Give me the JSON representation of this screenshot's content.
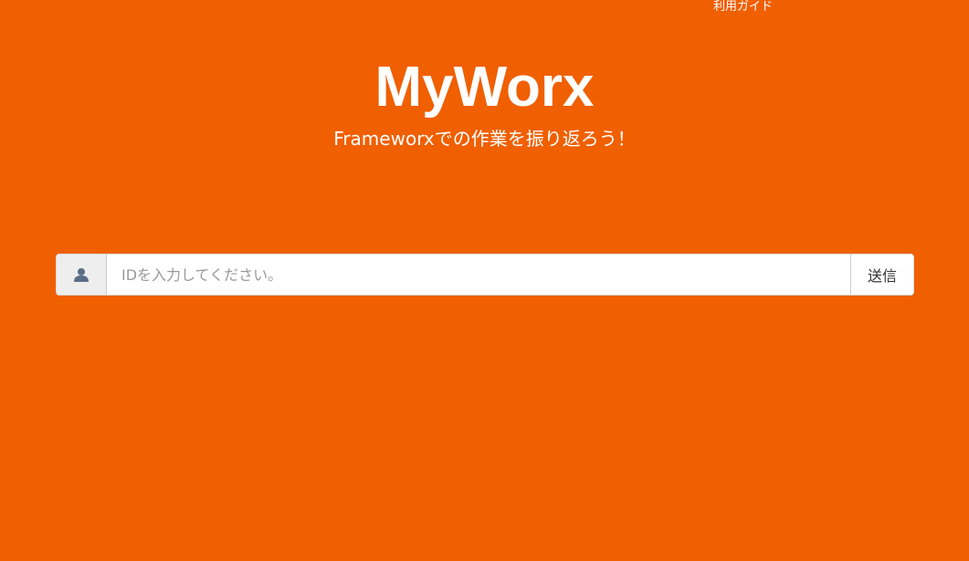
{
  "header": {
    "guide_link": "利用ガイド"
  },
  "hero": {
    "title": "MyWorx",
    "subtitle": "Frameworxでの作業を振り返ろう！"
  },
  "login": {
    "user_icon": "user-icon",
    "input_value": "",
    "input_placeholder": "IDを入力してください。",
    "submit_label": "送信"
  },
  "colors": {
    "background": "#f05f00",
    "text": "#ffffff",
    "icon": "#5a6e86"
  }
}
